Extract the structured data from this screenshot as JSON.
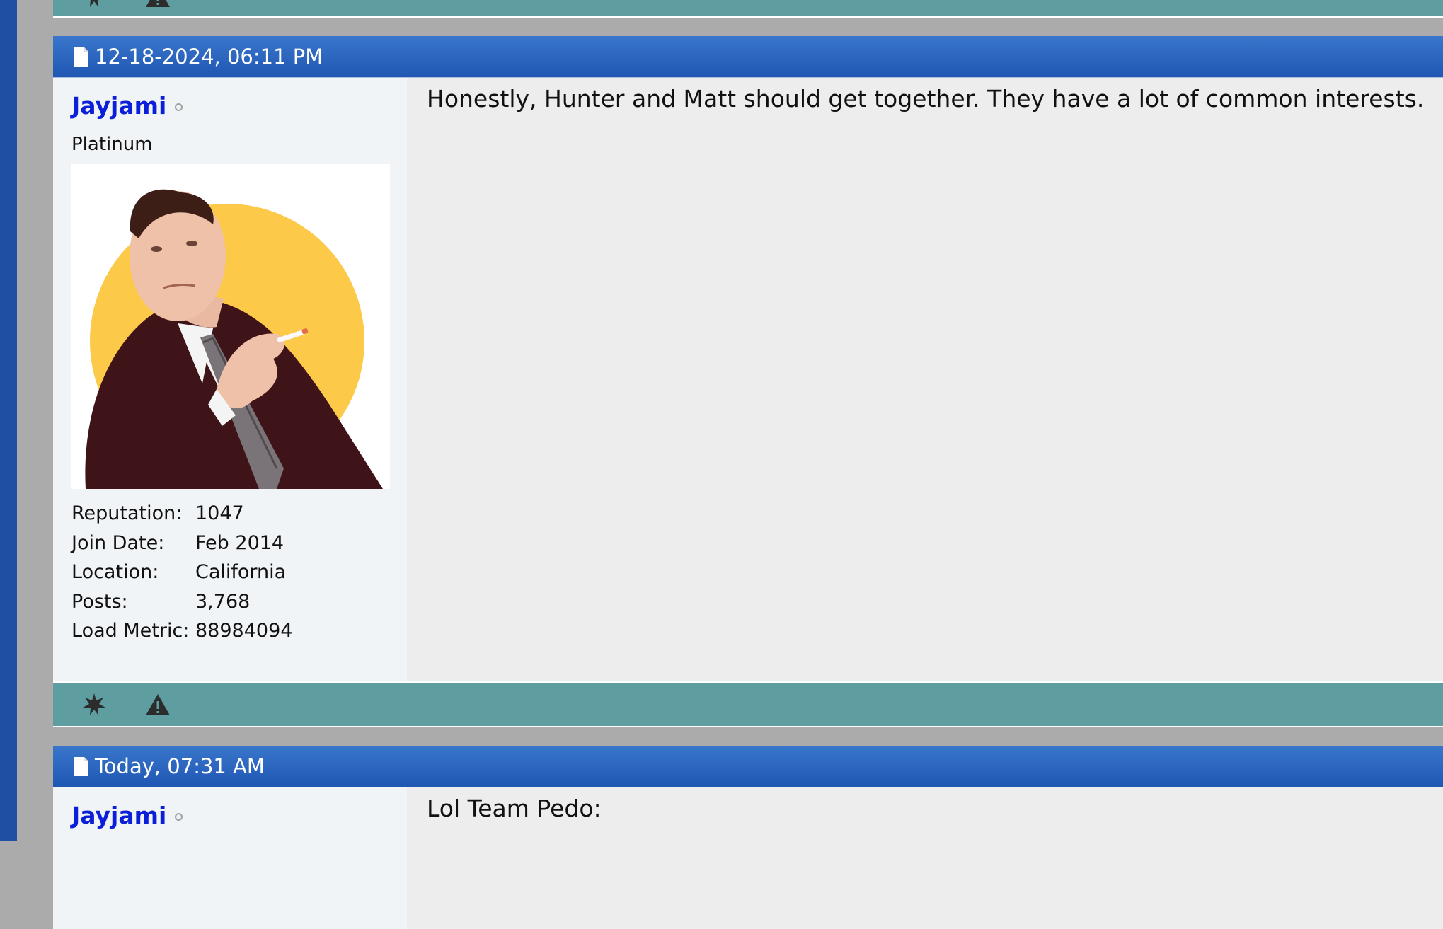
{
  "posts": [
    {
      "date": "12-18-2024, 06:11 PM",
      "username": "Jayjami",
      "user_title": "Platinum",
      "stats": [
        {
          "label": "Reputation:",
          "value": "1047"
        },
        {
          "label": "Join Date:",
          "value": "Feb 2014"
        },
        {
          "label": "Location:",
          "value": "California"
        },
        {
          "label": "Posts:",
          "value": "3,768"
        },
        {
          "label": "Load Metric:",
          "value": "88984094"
        }
      ],
      "message": "Honestly, Hunter and Matt should get together. They have a lot of common interests."
    },
    {
      "date": "Today, 07:31 AM",
      "username": "Jayjami",
      "message": "Lol Team Pedo:"
    }
  ],
  "icons": {
    "post_icon": "document-icon",
    "online_status": "offline-status-icon",
    "reputation_action": "star-icon",
    "report_action": "warning-icon"
  },
  "colors": {
    "header_blue": "#1f57b3",
    "footer_teal": "#5f9ea0",
    "username_blue": "#0b1fd9",
    "avatar_accent": "#fdc948"
  }
}
